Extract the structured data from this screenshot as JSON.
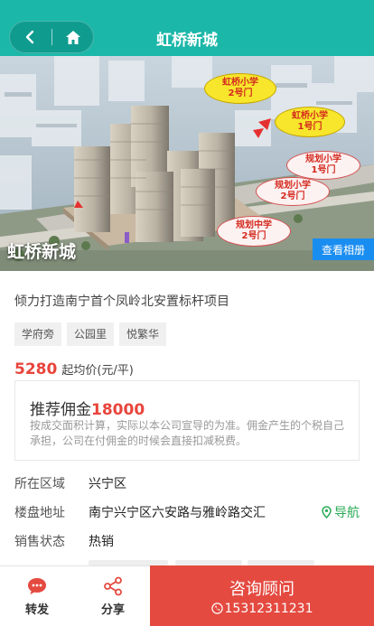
{
  "header": {
    "title": "虹桥新城"
  },
  "hero": {
    "overlay_name": "虹桥新城",
    "album_button": "查看相册",
    "callouts": [
      {
        "line1": "虹桥小学",
        "line2": "2号门"
      },
      {
        "line1": "虹桥小学",
        "line2": "1号门"
      },
      {
        "line1": "规划小学",
        "line2": "1号门"
      },
      {
        "line1": "规划小学",
        "line2": "2号门"
      },
      {
        "line1": "规划中学",
        "line2": "2号门"
      }
    ]
  },
  "project": {
    "slogan": "倾力打造南宁首个凤岭北安置标杆项目",
    "tags": [
      "学府旁",
      "公园里",
      "悦繁华"
    ],
    "price_value": "5280",
    "price_unit": "起均价(元/平)"
  },
  "commission": {
    "label": "推荐佣金",
    "value": "18000",
    "note": "按成交面积计算，实际以本公司宣导的为准。佣金产生的个税自己承担，公司在付佣金的时候会直接扣减税费。"
  },
  "info": {
    "district_label": "所在区域",
    "district_value": "兴宁区",
    "address_label": "楼盘地址",
    "address_value": "南宁兴宁区六安路与雅岭路交汇",
    "navigate_label": "导航",
    "status_label": "销售状态",
    "status_value": "热销"
  },
  "bottom_bar": {
    "forward_label": "转发",
    "share_label": "分享",
    "consult_title": "咨询顾问",
    "consult_phone": "15312311231"
  },
  "colors": {
    "teal": "#1bb7a8",
    "red": "#e44a40",
    "blue": "#1a8df0",
    "green": "#2aaa55"
  }
}
